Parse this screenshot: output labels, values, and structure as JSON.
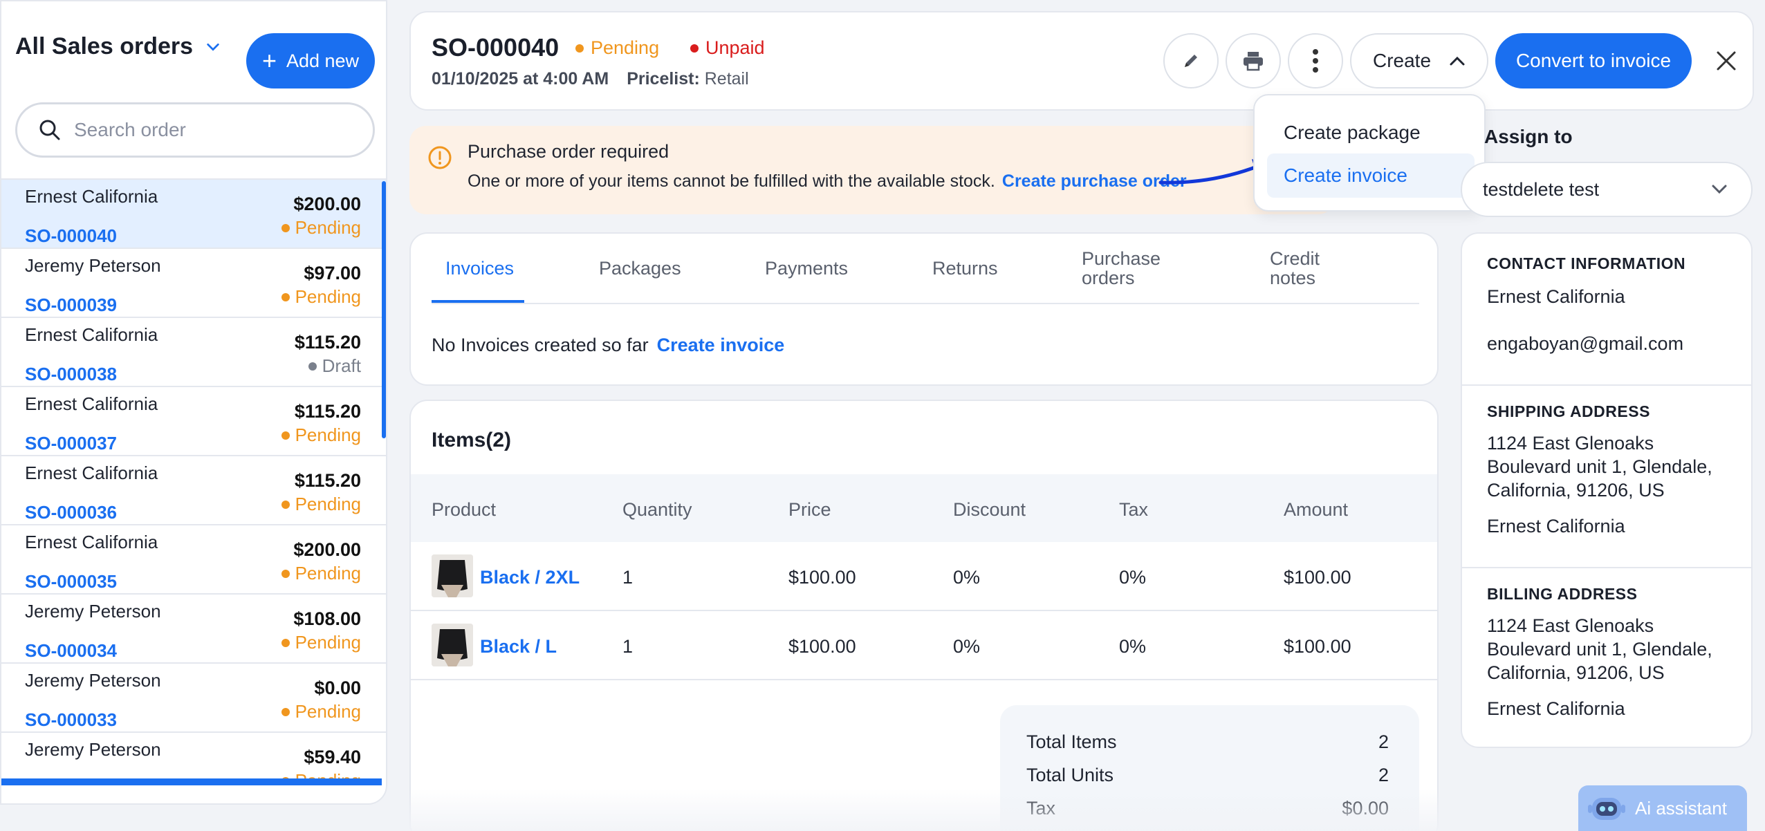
{
  "sidebar": {
    "title": "All Sales orders",
    "add_label": "Add new",
    "search_placeholder": "Search order",
    "orders": [
      {
        "name": "Ernest California",
        "so": "SO-000040",
        "amount": "$200.00",
        "status": "Pending"
      },
      {
        "name": "Jeremy Peterson",
        "so": "SO-000039",
        "amount": "$97.00",
        "status": "Pending"
      },
      {
        "name": "Ernest California",
        "so": "SO-000038",
        "amount": "$115.20",
        "status": "Draft"
      },
      {
        "name": "Ernest California",
        "so": "SO-000037",
        "amount": "$115.20",
        "status": "Pending"
      },
      {
        "name": "Ernest California",
        "so": "SO-000036",
        "amount": "$115.20",
        "status": "Pending"
      },
      {
        "name": "Ernest California",
        "so": "SO-000035",
        "amount": "$200.00",
        "status": "Pending"
      },
      {
        "name": "Jeremy Peterson",
        "so": "SO-000034",
        "amount": "$108.00",
        "status": "Pending"
      },
      {
        "name": "Jeremy Peterson",
        "so": "SO-000033",
        "amount": "$0.00",
        "status": "Pending"
      },
      {
        "name": "Jeremy Peterson",
        "so": "",
        "amount": "$59.40",
        "status": "Pending"
      }
    ]
  },
  "header": {
    "so_number": "SO-000040",
    "status": "Pending",
    "payment_status": "Unpaid",
    "date": "01/10/2025 at 4:00 AM",
    "pricelist_label": "Pricelist:",
    "pricelist_value": "Retail",
    "create_label": "Create",
    "convert_label": "Convert to invoice"
  },
  "create_menu": {
    "items": [
      "Create package",
      "Create invoice"
    ]
  },
  "alert": {
    "title": "Purchase order required",
    "message": "One or more of your items cannot be fulfilled with the available stock.",
    "link": "Create purchase order"
  },
  "tabs": {
    "items": [
      "Invoices",
      "Packages",
      "Payments",
      "Returns",
      "Purchase orders",
      "Credit notes"
    ],
    "active": "Invoices",
    "empty_text": "No Invoices created so far",
    "empty_link": "Create invoice"
  },
  "items": {
    "title": "Items(2)",
    "columns": [
      "Product",
      "Quantity",
      "Price",
      "Discount",
      "Tax",
      "Amount"
    ],
    "rows": [
      {
        "product": "Black / 2XL",
        "quantity": "1",
        "price": "$100.00",
        "discount": "0%",
        "tax": "0%",
        "amount": "$100.00"
      },
      {
        "product": "Black / L",
        "quantity": "1",
        "price": "$100.00",
        "discount": "0%",
        "tax": "0%",
        "amount": "$100.00"
      }
    ],
    "summary": [
      {
        "label": "Total Items",
        "value": "2"
      },
      {
        "label": "Total Units",
        "value": "2"
      },
      {
        "label": "Tax",
        "value": "$0.00"
      }
    ]
  },
  "assign": {
    "label": "Assign to",
    "value": "testdelete test"
  },
  "contact": {
    "title": "CONTACT INFORMATION",
    "name": "Ernest California",
    "email": "engaboyan@gmail.com"
  },
  "shipping": {
    "title": "SHIPPING ADDRESS",
    "address": "1124 East Glenoaks Boulevard unit 1, Glendale, California, 91206, US",
    "name": "Ernest California"
  },
  "billing": {
    "title": "BILLING ADDRESS",
    "address": "1124 East Glenoaks Boulevard unit 1, Glendale, California, 91206, US",
    "name": "Ernest California"
  },
  "ai": {
    "label": "Ai assistant"
  },
  "colors": {
    "accent": "#1a6ff0",
    "pending": "#f0961e",
    "unpaid": "#d91c1c",
    "draft": "#7a808c"
  }
}
